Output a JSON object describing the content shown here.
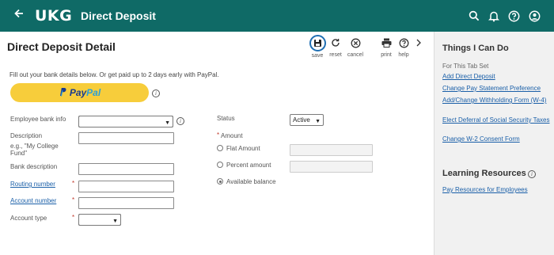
{
  "header": {
    "logo": "UKG",
    "title": "Direct Deposit"
  },
  "page": {
    "title": "Direct Deposit Detail",
    "intro": "Fill out your bank details below. Or get paid up to 2 days early with PayPal.",
    "paypal": {
      "part1": "Pay",
      "part2": "Pal"
    }
  },
  "toolbar": {
    "save": "save",
    "reset": "reset",
    "cancel": "cancel",
    "print": "print",
    "help": "help"
  },
  "form": {
    "employee_bank_info": {
      "label": "Employee bank info",
      "value": ""
    },
    "description": {
      "label": "Description",
      "hint": "e.g., \"My College Fund\"",
      "value": ""
    },
    "bank_description": {
      "label": "Bank description",
      "value": ""
    },
    "routing_number": {
      "label": "Routing number",
      "required": "*",
      "value": ""
    },
    "account_number": {
      "label": "Account number",
      "required": "*",
      "value": ""
    },
    "account_type": {
      "label": "Account type",
      "required": "*",
      "value": ""
    },
    "status": {
      "label": "Status",
      "value": "Active"
    },
    "amount": {
      "label": "Amount",
      "required": "*",
      "options": [
        "Flat Amount",
        "Percent amount",
        "Available balance"
      ],
      "selected": "Available balance"
    }
  },
  "sidebar": {
    "things_title": "Things I Can Do",
    "things_sub": "For This Tab Set",
    "links": [
      "Add Direct Deposit",
      "Change Pay Statement Preference",
      "Add/Change Withholding Form (W-4)",
      "Elect Deferral of Social Security Taxes",
      "Change W-2 Consent Form"
    ],
    "learning_title": "Learning Resources",
    "learning_links": [
      "Pay Resources for Employees"
    ]
  },
  "colors": {
    "header_bg": "#0f6a66",
    "paypal_yellow": "#f7cd3b",
    "link_blue": "#1a5fa8",
    "required_red": "#c0392b"
  }
}
